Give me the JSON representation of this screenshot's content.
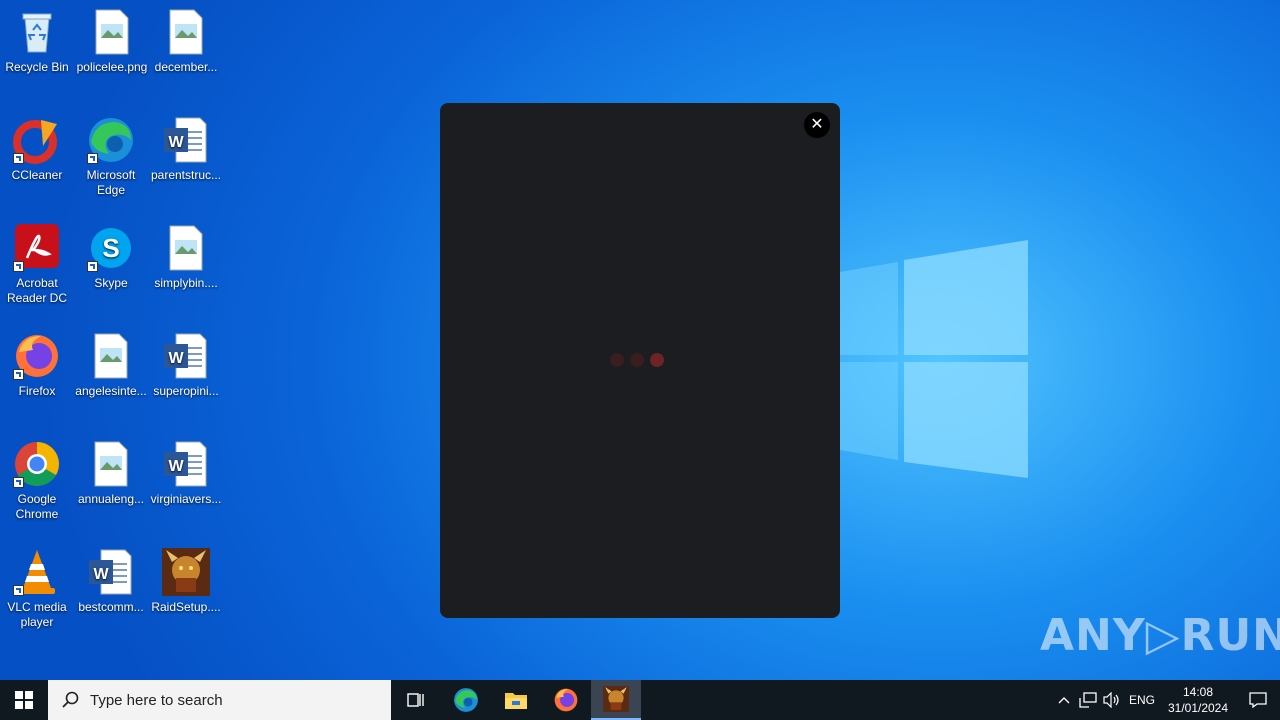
{
  "desktop": {
    "icons": [
      {
        "label": "Recycle Bin"
      },
      {
        "label": "policelee.png"
      },
      {
        "label": "december..."
      },
      {
        "label": "CCleaner"
      },
      {
        "label": "Microsoft Edge"
      },
      {
        "label": "parentstruc..."
      },
      {
        "label": "Acrobat Reader DC"
      },
      {
        "label": "Skype"
      },
      {
        "label": "simplybin...."
      },
      {
        "label": "Firefox"
      },
      {
        "label": "angelesinte..."
      },
      {
        "label": "superopini..."
      },
      {
        "label": "Google Chrome"
      },
      {
        "label": "annualeng..."
      },
      {
        "label": "virginiavers..."
      },
      {
        "label": "VLC media player"
      },
      {
        "label": "bestcomm..."
      },
      {
        "label": "RaidSetup...."
      }
    ]
  },
  "modal": {
    "close_glyph": "✕"
  },
  "watermark": {
    "text": "ANY▷RUN"
  },
  "taskbar": {
    "search_placeholder": "Type here to search",
    "language": "ENG",
    "time": "14:08",
    "date": "31/01/2024"
  },
  "colors": {
    "accent": "#0a64d8",
    "modal_bg": "#1b1d20",
    "taskbar_bg": "#101820"
  }
}
